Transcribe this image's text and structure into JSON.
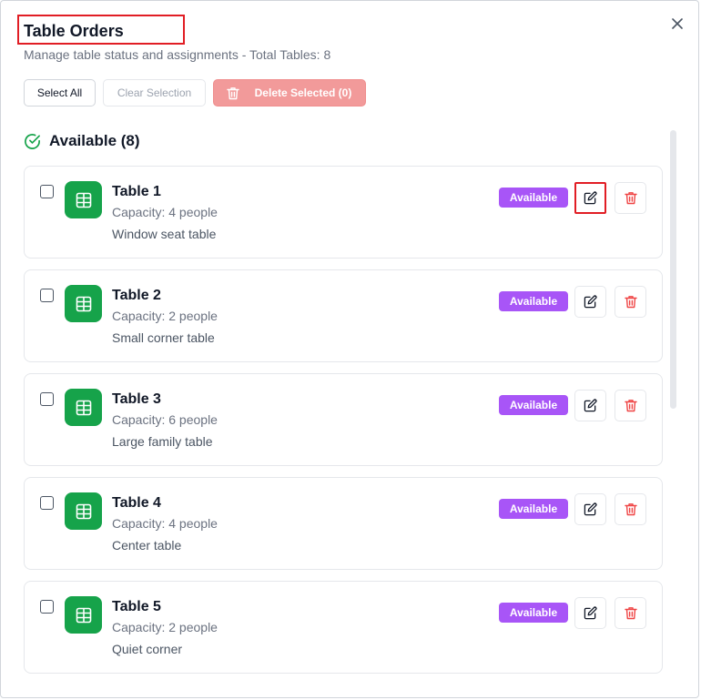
{
  "dialog": {
    "title": "Table Orders",
    "subtitle": "Manage table status and assignments - Total Tables: 8"
  },
  "toolbar": {
    "select_all_label": "Select All",
    "clear_selection_label": "Clear Selection",
    "delete_selected_label": "Delete Selected (0)"
  },
  "section": {
    "heading": "Available (8)"
  },
  "tables": [
    {
      "name": "Table 1",
      "capacity": "Capacity: 4 people",
      "description": "Window seat table",
      "status": "Available"
    },
    {
      "name": "Table 2",
      "capacity": "Capacity: 2 people",
      "description": "Small corner table",
      "status": "Available"
    },
    {
      "name": "Table 3",
      "capacity": "Capacity: 6 people",
      "description": "Large family table",
      "status": "Available"
    },
    {
      "name": "Table 4",
      "capacity": "Capacity: 4 people",
      "description": "Center table",
      "status": "Available"
    },
    {
      "name": "Table 5",
      "capacity": "Capacity: 2 people",
      "description": "Quiet corner",
      "status": "Available"
    }
  ],
  "icons": {
    "close": "close-icon",
    "section": "check-circle-icon",
    "table_tile": "table-grid-icon",
    "edit": "edit-icon",
    "delete": "trash-icon"
  },
  "colors": {
    "accent_green": "#16a34a",
    "status_purple": "#a855f7",
    "danger_red": "#ef4444",
    "delete_button_disabled": "#f29a9a",
    "highlight_red": "#e11d24"
  }
}
